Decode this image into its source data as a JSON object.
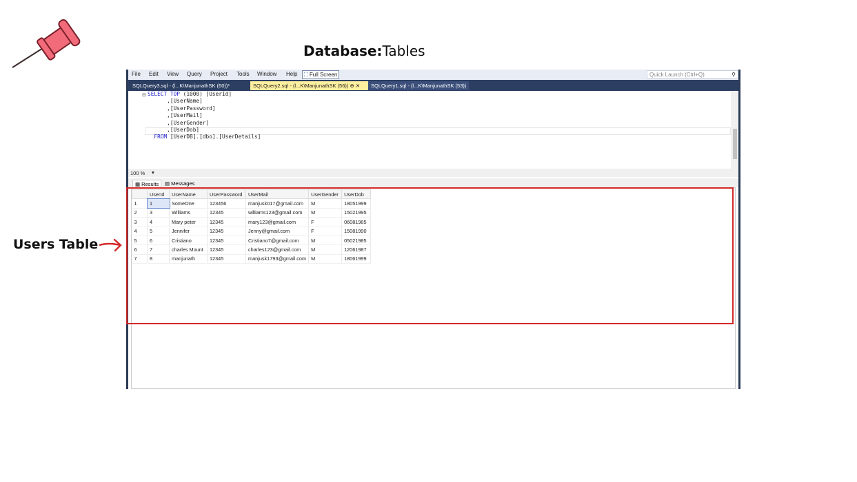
{
  "heading": {
    "bold": "Database:",
    "normal": "Tables"
  },
  "annotation": {
    "label": "Users Table",
    "color": "#d42828"
  },
  "menu": [
    "File",
    "Edit",
    "View",
    "Query",
    "Project",
    "Tools",
    "Window",
    "Help"
  ],
  "fullscreen_label": "Full Screen",
  "quick_launch_placeholder": "Quick Launch (Ctrl+Q)",
  "tabs": [
    {
      "label": "SQLQuery3.sql - (l...K\\ManjunathSK (60))*",
      "state": "inactive"
    },
    {
      "label": "SQLQuery2.sql - (l...K\\ManjunathSK (56))",
      "state": "active"
    },
    {
      "label": "SQLQuery1.sql - (l...K\\ManjunathSK (53))",
      "state": "inactive"
    }
  ],
  "code_lines": [
    {
      "kw": "SELECT TOP",
      "rest": " (1000) [UserId]"
    },
    {
      "kw": "",
      "rest": "      ,[UserName]"
    },
    {
      "kw": "",
      "rest": "      ,[UserPassword]"
    },
    {
      "kw": "",
      "rest": "      ,[UserMail]"
    },
    {
      "kw": "",
      "rest": "      ,[UserGender]"
    },
    {
      "kw": "",
      "rest": "      ,[UserDob]"
    },
    {
      "kw": "  FROM",
      "rest": " [UserDB].[dbo].[UserDetails]"
    }
  ],
  "zoom": "100 %",
  "result_tabs": [
    "Results",
    "Messages"
  ],
  "columns": [
    "UserId",
    "UserName",
    "UserPassword",
    "UserMail",
    "UserGender",
    "UserDob"
  ],
  "rows": [
    [
      "1",
      "1",
      "SomeOne",
      "123456",
      "manjusk017@gmail.com",
      "M",
      "18051999"
    ],
    [
      "2",
      "3",
      "Williams",
      "12345",
      "williams123@gmail.com",
      "M",
      "15021995"
    ],
    [
      "3",
      "4",
      "Mary peter",
      "12345",
      "mary123@gmail.com",
      "F",
      "06081985"
    ],
    [
      "4",
      "5",
      "Jennifer",
      "12345",
      "Jenny@gmail.com",
      "F",
      "15081990"
    ],
    [
      "5",
      "6",
      "Cristiano",
      "12345",
      "Cristiano7@gmail.com",
      "M",
      "05021985"
    ],
    [
      "6",
      "7",
      "charles Mount",
      "12345",
      "charles123@gmail.com",
      "M",
      "12061987"
    ],
    [
      "7",
      "8",
      "manjunath",
      "12345",
      "manjusk1793@gmail.com",
      "M",
      "18061999"
    ]
  ]
}
